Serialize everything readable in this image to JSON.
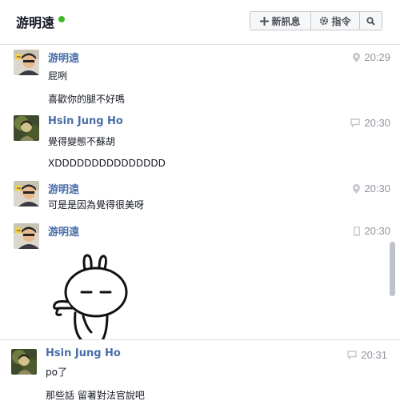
{
  "header": {
    "title": "游明遠",
    "new_message_label": "新訊息",
    "command_label": "指令"
  },
  "colors": {
    "name_blue": "#4a6ea9",
    "online_green": "#42b72a",
    "timestamp_gray": "#90949c"
  },
  "messages": [
    {
      "sender": "游明遠",
      "time": "20:29",
      "source_icon": "location-pin-icon",
      "lines": [
        "屁咧",
        "喜歡你的腿不好嗎"
      ]
    },
    {
      "sender": "Hsin Jung Ho",
      "time": "20:30",
      "source_icon": "chat-bubble-icon",
      "lines": [
        "覺得變態不蘇胡",
        "XDDDDDDDDDDDDDDD"
      ]
    },
    {
      "sender": "游明遠",
      "time": "20:30",
      "source_icon": "location-pin-icon",
      "lines": [
        "可是是因為覺得很美呀"
      ]
    },
    {
      "sender": "游明遠",
      "time": "20:30",
      "source_icon": "mobile-phone-icon",
      "sticker": "rabbit-sticker"
    }
  ],
  "bottom_message": {
    "sender": "Hsin Jung Ho",
    "time": "20:31",
    "source_icon": "chat-bubble-icon",
    "lines": [
      "po了",
      "那些話 留著對法官說吧"
    ]
  }
}
